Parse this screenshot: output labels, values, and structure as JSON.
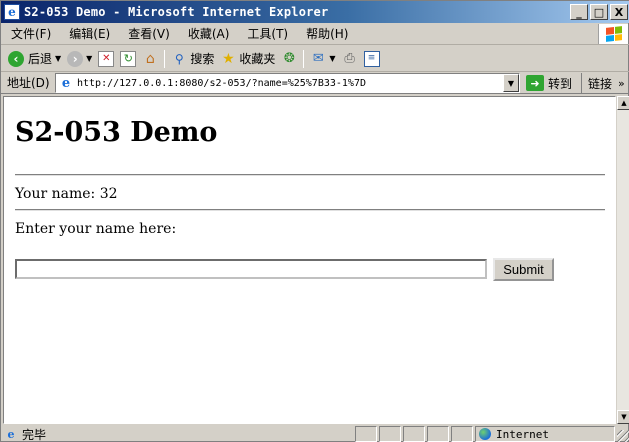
{
  "window": {
    "title": "S2-053 Demo - Microsoft Internet Explorer",
    "minimize": "_",
    "maximize": "□",
    "close": "X"
  },
  "menubar": {
    "items": [
      "文件(F)",
      "编辑(E)",
      "查看(V)",
      "收藏(A)",
      "工具(T)",
      "帮助(H)"
    ]
  },
  "toolbar": {
    "back": "后退",
    "search": "搜索",
    "favorites": "收藏夹"
  },
  "addressbar": {
    "label": "地址(D)",
    "url": "http://127.0.0.1:8080/s2-053/?name=%25%7B33-1%7D",
    "go": "转到",
    "links": "链接"
  },
  "page": {
    "heading": "S2-053 Demo",
    "your_name": "Your name: 32",
    "enter_label": "Enter your name here:",
    "input_value": "",
    "submit": "Submit"
  },
  "statusbar": {
    "text": "完毕",
    "zone": "Internet"
  },
  "colors": {
    "titlebar_start": "#0a246a",
    "titlebar_end": "#a6caf0",
    "chrome": "#d4d0c8",
    "go_green": "#2fa531"
  },
  "icons": [
    "ie-icon",
    "windows-logo-icon",
    "back-icon",
    "forward-icon",
    "stop-icon",
    "refresh-icon",
    "home-icon",
    "search-icon",
    "favorites-icon",
    "media-icon",
    "mail-icon",
    "print-icon",
    "edit-icon",
    "go-icon",
    "globe-icon"
  ]
}
